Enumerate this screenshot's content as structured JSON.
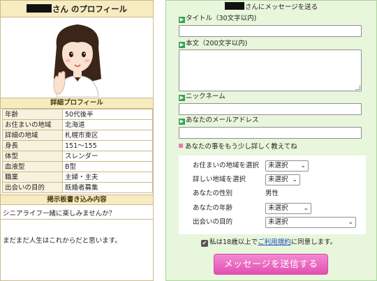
{
  "profile": {
    "title_suffix": "さん のプロフィール",
    "details_heading": "詳細プロフィール",
    "details": [
      {
        "label": "年齢",
        "value": "50代後半"
      },
      {
        "label": "お住まいの地域",
        "value": "北海道"
      },
      {
        "label": "詳細の地域",
        "value": "札幌市東区"
      },
      {
        "label": "身長",
        "value": "151～155"
      },
      {
        "label": "体型",
        "value": "スレンダー"
      },
      {
        "label": "血液型",
        "value": "B型"
      },
      {
        "label": "職業",
        "value": "主婦・主夫"
      },
      {
        "label": "出会いの目的",
        "value": "既婚者募集"
      }
    ],
    "board_heading": "掲示板書き込み内容",
    "board_line1": "シニアライフ一緒に楽しみませんか？",
    "board_line2": "まだまだ人生はこれからだと思います。"
  },
  "message": {
    "title_suffix": "さんにメッセージを送る",
    "arrow_glyph": "▶",
    "subject_label": "タイトル（30文字以内)",
    "body_label": "本文（200文字以内)",
    "nickname_label": "ニックネーム",
    "email_label": "あなたのメールアドレス",
    "more_label": "あなたの事をもう少し詳しく教えてね",
    "fields": {
      "area_label": "お住まいの地域を選択",
      "area_value": "未選択",
      "detail_area_label": "詳しい地域を選択",
      "detail_area_value": "未選択",
      "gender_label": "あなたの性別",
      "gender_value": "男性",
      "age_label": "あなたの年齢",
      "age_value": "未選択",
      "purpose_label": "出会いの目的",
      "purpose_value": "未選択"
    },
    "agree_check": "✔",
    "agree_before": "私は18歳以上で",
    "agree_link": "ご利用規約",
    "agree_after": "に同意します。",
    "send_button": "メッセージを送信する",
    "chevron": "⌄"
  },
  "colors": {
    "profile_header": "#f7ebc0",
    "profile_border": "#c9b98e",
    "message_bg": "#e8f6dc",
    "send_button": "#e24fb3",
    "arrow_green": "#3aa25a"
  }
}
